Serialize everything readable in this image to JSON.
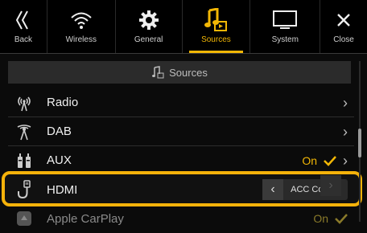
{
  "nav": {
    "back": {
      "label": "Back",
      "icon": "double-chevron-left-icon"
    },
    "wireless": {
      "label": "Wireless",
      "icon": "wifi-icon"
    },
    "general": {
      "label": "General",
      "icon": "gear-icon"
    },
    "sources": {
      "label": "Sources",
      "icon": "music-note-icon"
    },
    "system": {
      "label": "System",
      "icon": "monitor-icon"
    },
    "close": {
      "label": "Close",
      "icon": "close-icon"
    }
  },
  "section": {
    "title": "Sources",
    "icon": "music-note-icon"
  },
  "rows": [
    {
      "label": "Radio",
      "icon": "antenna-icon"
    },
    {
      "label": "DAB",
      "icon": "dab-antenna-icon"
    },
    {
      "label": "AUX",
      "icon": "aux-jack-icon",
      "status": "On"
    },
    {
      "label": "HDMI",
      "icon": "hdmi-cable-icon",
      "value": "ACC Control"
    },
    {
      "label": "Apple CarPlay",
      "icon": "carplay-icon",
      "status": "On"
    }
  ],
  "colors": {
    "accent": "#f2b705",
    "highlight": "#f5b20a"
  }
}
